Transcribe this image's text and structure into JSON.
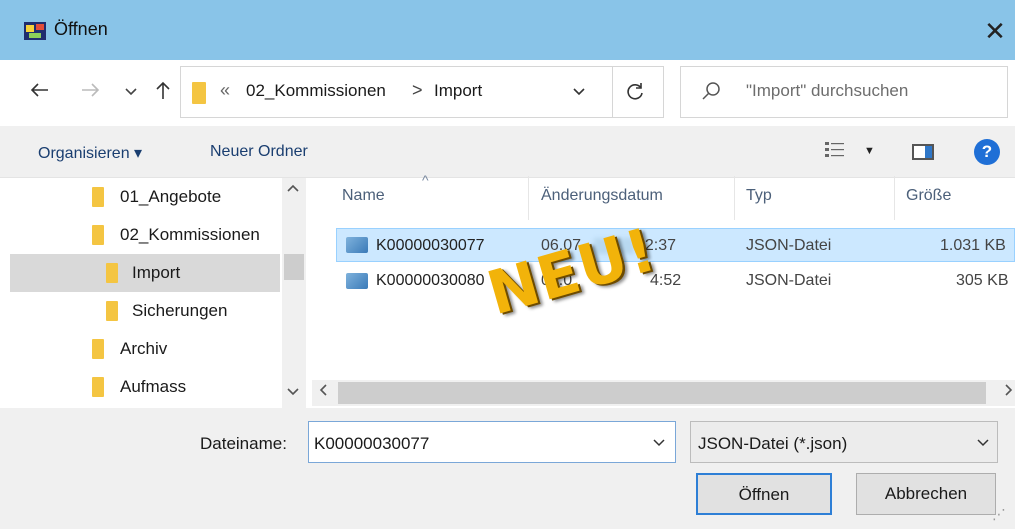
{
  "window": {
    "title": "Öffnen",
    "close_glyph": "✕"
  },
  "address_bar": {
    "path_prefix": "«",
    "crumbs": [
      "02_Kommissionen",
      "Import"
    ],
    "separator": ">",
    "search_placeholder": "\"Import\" durchsuchen"
  },
  "toolbar": {
    "organize_label": "Organisieren ▾",
    "new_folder_label": "Neuer Ordner",
    "help_glyph": "?"
  },
  "nav_pane": {
    "items": [
      {
        "label": "01_Angebote",
        "selected": false,
        "indent": 1
      },
      {
        "label": "02_Kommissionen",
        "selected": false,
        "indent": 1
      },
      {
        "label": "Import",
        "selected": true,
        "indent": 2
      },
      {
        "label": "Sicherungen",
        "selected": false,
        "indent": 2
      },
      {
        "label": "Archiv",
        "selected": false,
        "indent": 1
      },
      {
        "label": "Aufmass",
        "selected": false,
        "indent": 1
      }
    ]
  },
  "file_list": {
    "columns": [
      "Name",
      "Änderungsdatum",
      "Typ",
      "Größe"
    ],
    "rows": [
      {
        "name": "K00000030077",
        "date_visible": "06.07.",
        "time_visible": "12:37",
        "type": "JSON-Datei",
        "size": "1.031 KB",
        "selected": true
      },
      {
        "name": "K00000030080",
        "date_visible": "06.0",
        "time_visible": "4:52",
        "type": "JSON-Datei",
        "size": "305 KB",
        "selected": false
      }
    ]
  },
  "overlay": {
    "stamp_text": "NEU!",
    "stamp_color": "#f2b30a"
  },
  "footer": {
    "filename_label": "Dateiname:",
    "filename_value": "K00000030077",
    "filetype_value": "JSON-Datei (*.json)",
    "open_button": "Öffnen",
    "cancel_button": "Abbrechen"
  },
  "icons": {
    "back": "back-arrow-icon",
    "forward": "forward-arrow-icon",
    "recent": "recent-locations-icon",
    "up": "up-arrow-icon",
    "refresh": "refresh-icon",
    "search": "search-icon",
    "view": "view-options-icon",
    "preview": "preview-pane-icon",
    "help": "help-icon",
    "folder": "folder-icon",
    "json_file": "json-file-icon"
  },
  "colors": {
    "titlebar": "#89c4e8",
    "selection": "#cce8ff",
    "nav_selection": "#d9d9d9",
    "link": "#1a3e70",
    "primary_button_border": "#2e7fd6"
  }
}
